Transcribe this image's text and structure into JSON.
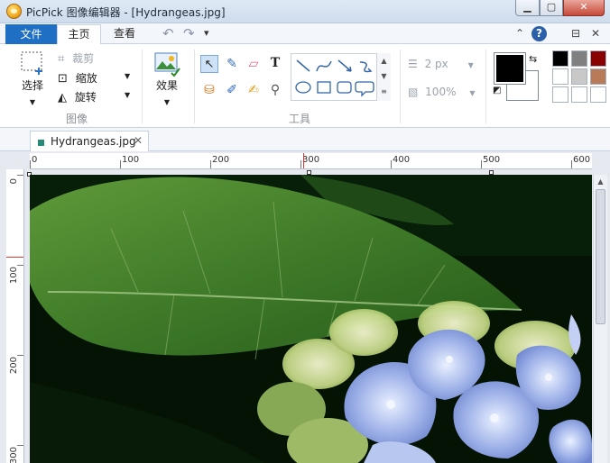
{
  "window": {
    "title": "PicPick 图像编辑器 - [Hydrangeas.jpg]",
    "minimize_label": "▁",
    "maximize_label": "▢",
    "close_label": "✕"
  },
  "tabs": {
    "file": "文件",
    "home": "主页",
    "view": "查看"
  },
  "quick_access": {
    "undo": "↶",
    "redo": "↷",
    "more": "▾"
  },
  "tabrow_right": {
    "collapse": "⌃",
    "help": "?",
    "restore": "⊟",
    "close": "✕"
  },
  "ribbon": {
    "select_label": "选择",
    "crop_label": "裁剪",
    "resize_label": "缩放",
    "rotate_label": "旋转",
    "image_group_label": "图像",
    "effects_label": "效果",
    "tools_group_label": "工具",
    "line_width": "2 px",
    "opacity": "100%"
  },
  "colors": {
    "primary": "#000000",
    "secondary": "#ffffff",
    "swatches": [
      "#000000",
      "#808080",
      "#8b0000",
      "#ffffff",
      "#c8c8c8",
      "#b97a57",
      "#ffffff",
      "#ffffff",
      "#ffffff"
    ]
  },
  "document": {
    "tab_name": "Hydrangeas.jpg",
    "close": "✕"
  },
  "rulers": {
    "h_labels": [
      "0",
      "100",
      "200",
      "300",
      "400",
      "500",
      "600"
    ],
    "v_labels": [
      "0",
      "100",
      "200",
      "300"
    ]
  },
  "icons": {
    "select": "select-icon",
    "crop": "crop-icon",
    "resize": "resize-icon",
    "rotate": "rotate-icon",
    "effects": "effects-icon",
    "text": "text-tool-icon"
  }
}
